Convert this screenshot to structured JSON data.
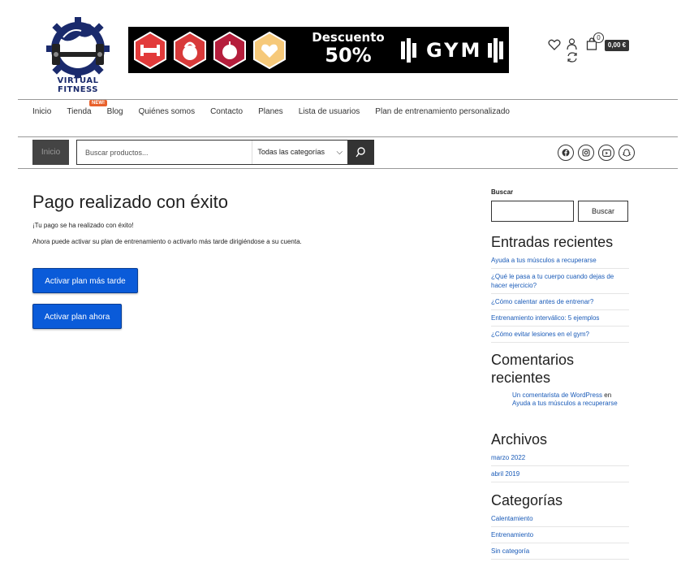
{
  "brand": {
    "name": "VIRTUAL FITNESS"
  },
  "banner": {
    "discount_line1": "Descuento",
    "discount_line2": "50%",
    "gym_text": "GYM",
    "hex_colors": [
      "#e23b3b",
      "#d83a3a",
      "#b51e3c",
      "#f6c97a"
    ],
    "hex_icons": [
      "dumbbell-icon",
      "kettlebell-icon",
      "apple-icon",
      "heart-icon"
    ]
  },
  "header": {
    "cart_count": "0",
    "cart_total": "0,00 €"
  },
  "nav": {
    "items": [
      "Inicio",
      "Tienda",
      "Blog",
      "Quiénes somos",
      "Contacto",
      "Planes",
      "Lista de usuarios",
      "Plan de entrenamiento personalizado"
    ],
    "new_badge": "NEW!"
  },
  "searchbar": {
    "home_label": "Inicio",
    "placeholder": "Buscar productos...",
    "category": "Todas las categorías"
  },
  "social": [
    "facebook-icon",
    "instagram-icon",
    "youtube-icon",
    "snapchat-icon"
  ],
  "main": {
    "title": "Pago realizado con éxito",
    "message1": "¡Tu pago se ha realizado con éxito!",
    "message2": "Ahora puede activar su plan de entrenamiento o activarlo más tarde dirigiéndose a su cuenta.",
    "btn_later": "Activar plan más tarde",
    "btn_now": "Activar plan ahora"
  },
  "sidebar": {
    "search_label": "Buscar",
    "search_button": "Buscar",
    "recent_title": "Entradas recientes",
    "recent_posts": [
      "Ayuda a tus músculos a recuperarse",
      "¿Qué le pasa a tu cuerpo cuando dejas de hacer ejercicio?",
      "¿Cómo calentar antes de entrenar?",
      "Entrenamiento interválico: 5 ejemplos",
      "¿Cómo evitar lesiones en el gym?"
    ],
    "comments_title": "Comentarios recientes",
    "comment_author": "Un comentarista de WordPress",
    "comment_on": "en",
    "comment_post": "Ayuda a tus músculos a recuperarse",
    "archives_title": "Archivos",
    "archives": [
      "marzo 2022",
      "abril 2019"
    ],
    "categories_title": "Categorías",
    "categories": [
      "Calentamiento",
      "Entrenamiento",
      "Sin categoría"
    ]
  }
}
